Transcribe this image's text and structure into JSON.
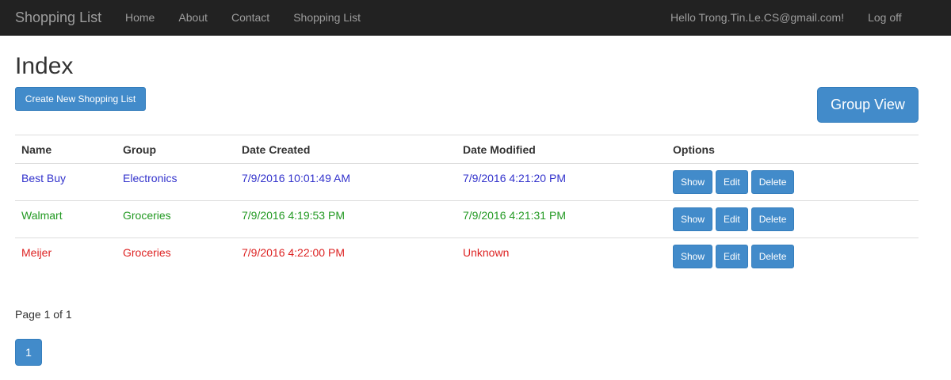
{
  "navbar": {
    "brand": "Shopping List",
    "links": [
      "Home",
      "About",
      "Contact",
      "Shopping List"
    ],
    "greeting": "Hello Trong.Tin.Le.CS@gmail.com!",
    "logoff": "Log off"
  },
  "page": {
    "title": "Index",
    "create_button": "Create New Shopping List",
    "group_view_button": "Group View"
  },
  "table": {
    "headers": [
      "Name",
      "Group",
      "Date Created",
      "Date Modified",
      "Options"
    ],
    "rows": [
      {
        "name": "Best Buy",
        "group": "Electronics",
        "created": "7/9/2016 10:01:49 AM",
        "modified": "7/9/2016 4:21:20 PM",
        "color": "#3333cc"
      },
      {
        "name": "Walmart",
        "group": "Groceries",
        "created": "7/9/2016 4:19:53 PM",
        "modified": "7/9/2016 4:21:31 PM",
        "color": "#229922"
      },
      {
        "name": "Meijer",
        "group": "Groceries",
        "created": "7/9/2016 4:22:00 PM",
        "modified": "Unknown",
        "color": "#dd2222"
      }
    ],
    "options": {
      "show": "Show",
      "edit": "Edit",
      "delete": "Delete"
    }
  },
  "pager": {
    "text": "Page 1 of 1",
    "current": "1"
  },
  "colors": {
    "navbar_bg": "#222222",
    "primary": "#428bca"
  }
}
